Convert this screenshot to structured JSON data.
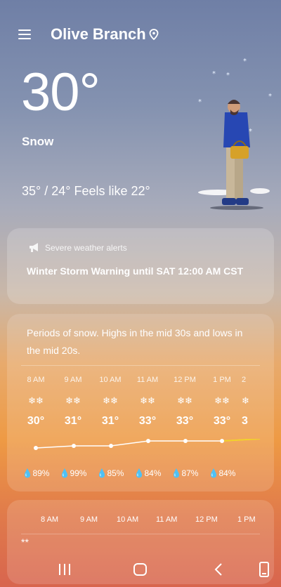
{
  "header": {
    "location": "Olive Branch",
    "menu_icon": "menu-icon",
    "pin_icon": "location-pin-icon"
  },
  "current": {
    "temperature": "30°",
    "condition": "Snow",
    "hilo_feels": "35° / 24° Feels like 22°"
  },
  "alerts": {
    "title": "Severe weather alerts",
    "text": "Winter Storm Warning until SAT 12:00 AM CST",
    "icon": "megaphone-icon"
  },
  "forecast": {
    "summary": "Periods of snow. Highs in the mid 30s and lows in the mid 20s.",
    "hours": [
      {
        "time": "8 AM",
        "icon": "snow-icon",
        "temp": "30°",
        "precip": "89%"
      },
      {
        "time": "9 AM",
        "icon": "snow-icon",
        "temp": "31°",
        "precip": "99%"
      },
      {
        "time": "10 AM",
        "icon": "snow-icon",
        "temp": "31°",
        "precip": "85%"
      },
      {
        "time": "11 AM",
        "icon": "snow-icon",
        "temp": "33°",
        "precip": "84%"
      },
      {
        "time": "12 PM",
        "icon": "snow-icon",
        "temp": "33°",
        "precip": "87%"
      },
      {
        "time": "1 PM",
        "icon": "snow-icon",
        "temp": "33°",
        "precip": "84%"
      },
      {
        "time": "2",
        "icon": "snow-icon",
        "temp": "3",
        "precip": ""
      }
    ]
  },
  "hourly2": {
    "times": [
      "8 AM",
      "9 AM",
      "10 AM",
      "11 AM",
      "12 PM",
      "1 PM"
    ]
  },
  "navbar": {
    "recents_icon": "recent-apps-icon",
    "home_icon": "home-icon",
    "back_icon": "back-icon",
    "screen_icon": "phone-screen-icon"
  },
  "colors": {
    "line": "#ffffff",
    "line_accent": "#f2d12a"
  }
}
